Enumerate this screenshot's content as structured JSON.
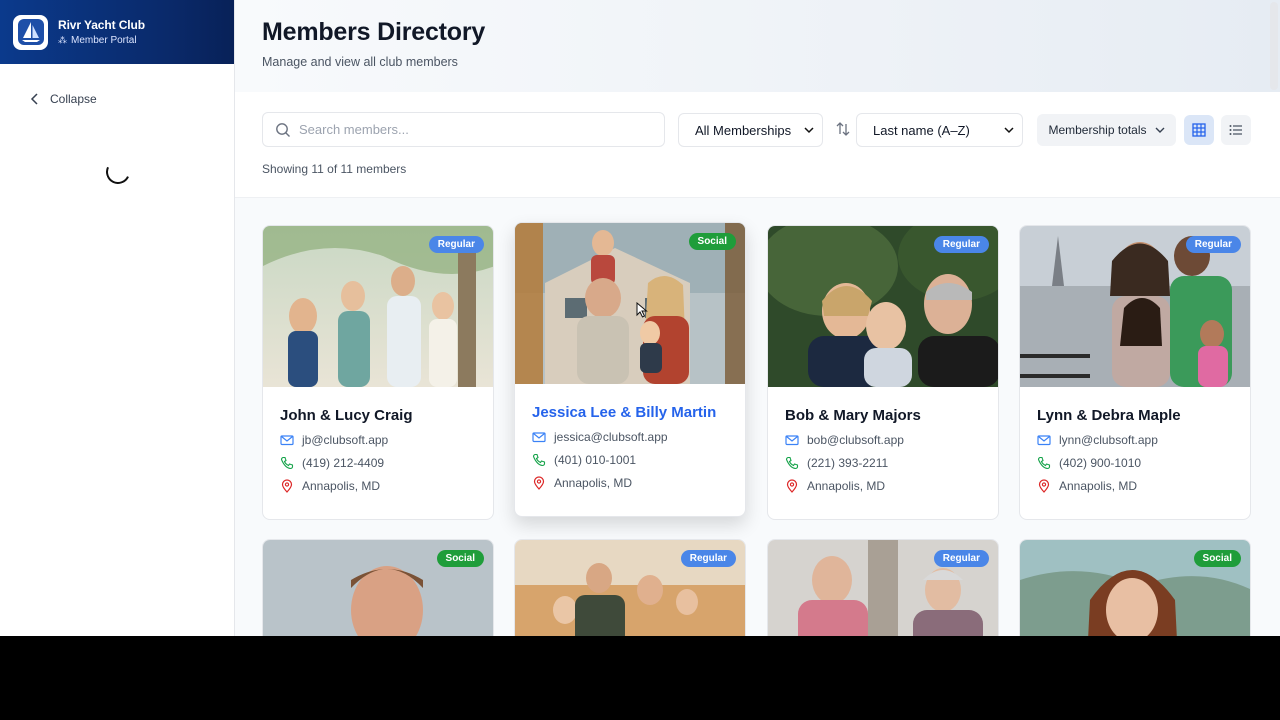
{
  "brand": {
    "title": "Rivr Yacht Club",
    "subtitle": "Member Portal"
  },
  "sidebar": {
    "collapse_label": "Collapse"
  },
  "header": {
    "title": "Members Directory",
    "subtitle": "Manage and view all club members"
  },
  "toolbar": {
    "search_placeholder": "Search members...",
    "membership_filter": "All Memberships",
    "sort_value": "Last name (A–Z)",
    "totals_label": "Membership totals",
    "showing_text": "Showing 11 of 11 members"
  },
  "members": [
    {
      "name": "John & Lucy Craig",
      "email": "jb@clubsoft.app",
      "phone": "(419) 212-4409",
      "location": "Annapolis, MD",
      "membership": "Regular"
    },
    {
      "name": "Jessica Lee & Billy Martin",
      "email": "jessica@clubsoft.app",
      "phone": "(401) 010-1001",
      "location": "Annapolis, MD",
      "membership": "Social"
    },
    {
      "name": "Bob & Mary Majors",
      "email": "bob@clubsoft.app",
      "phone": "(221) 393-2211",
      "location": "Annapolis, MD",
      "membership": "Regular"
    },
    {
      "name": "Lynn & Debra Maple",
      "email": "lynn@clubsoft.app",
      "phone": "(402) 900-1010",
      "location": "Annapolis, MD",
      "membership": "Regular"
    },
    {
      "membership": "Social"
    },
    {
      "membership": "Regular"
    },
    {
      "membership": "Regular"
    },
    {
      "membership": "Social"
    }
  ],
  "colors": {
    "brand": "#0b3a8c",
    "regular_badge": "#4a86e8",
    "social_badge": "#1f9d3a",
    "link_hover": "#2563eb"
  }
}
